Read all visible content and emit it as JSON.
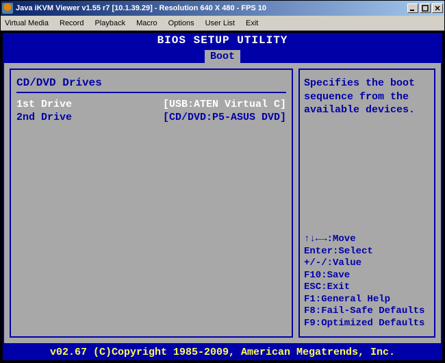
{
  "window": {
    "title": "Java iKVM Viewer v1.55 r7 [10.1.39.29] - Resolution 640 X 480 - FPS 10"
  },
  "menubar": {
    "items": [
      "Virtual Media",
      "Record",
      "Playback",
      "Macro",
      "Options",
      "User List",
      "Exit"
    ]
  },
  "bios": {
    "title": "BIOS SETUP UTILITY",
    "active_tab": "Boot",
    "section_title": "CD/DVD Drives",
    "drives": [
      {
        "label": "1st Drive",
        "value": "[USB:ATEN Virtual C]",
        "selected": true
      },
      {
        "label": "2nd Drive",
        "value": "[CD/DVD:P5-ASUS DVD]",
        "selected": false
      }
    ],
    "help_text": "Specifies the boot sequence from the available devices.",
    "keys": [
      "↑↓←→:Move",
      "Enter:Select",
      "+/-/:Value",
      "F10:Save",
      "ESC:Exit",
      "F1:General Help",
      "F8:Fail-Safe Defaults",
      "F9:Optimized Defaults"
    ],
    "footer": "v02.67 (C)Copyright 1985-2009, American Megatrends, Inc."
  }
}
